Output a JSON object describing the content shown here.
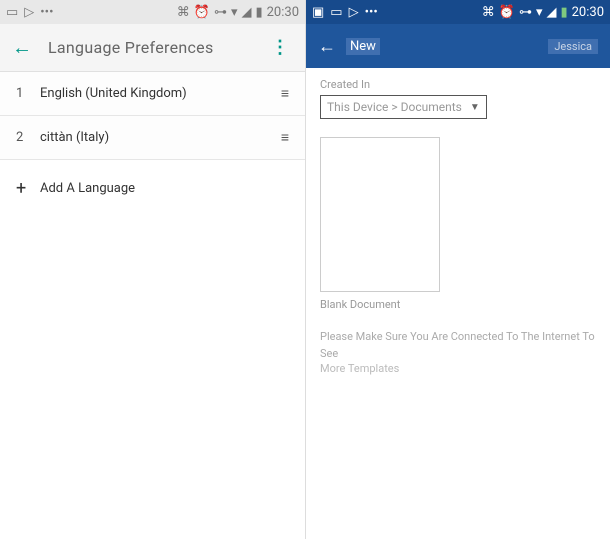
{
  "left": {
    "statusbar": {
      "time": "20:30",
      "icons": [
        "laptop-icon",
        "play-icon",
        "dots-icon",
        "bluetooth-icon",
        "alarm-icon",
        "key-icon",
        "wifi-icon",
        "signal-icon",
        "battery-icon"
      ]
    },
    "appbar": {
      "title": "Language Preferences"
    },
    "languages": [
      {
        "index": "1",
        "name": "English (United Kingdom)"
      },
      {
        "index": "2",
        "name": "cittàn (Italy)"
      }
    ],
    "add_label": "Add A Language"
  },
  "right": {
    "statusbar": {
      "time": "20:30",
      "icons": [
        "image-icon",
        "laptop-icon",
        "play-icon",
        "dots-icon",
        "bluetooth-icon",
        "alarm-icon",
        "key-icon",
        "wifi-icon",
        "signal-icon",
        "battery-icon"
      ]
    },
    "appbar": {
      "new_label": "New",
      "user": "Jessica"
    },
    "created_in_label": "Created In",
    "dropdown_value": "This Device > Documents",
    "blank_doc_label": "Blank Document",
    "message_line1": "Please Make Sure You Are Connected To The Internet To See",
    "message_line2": "More Templates"
  }
}
